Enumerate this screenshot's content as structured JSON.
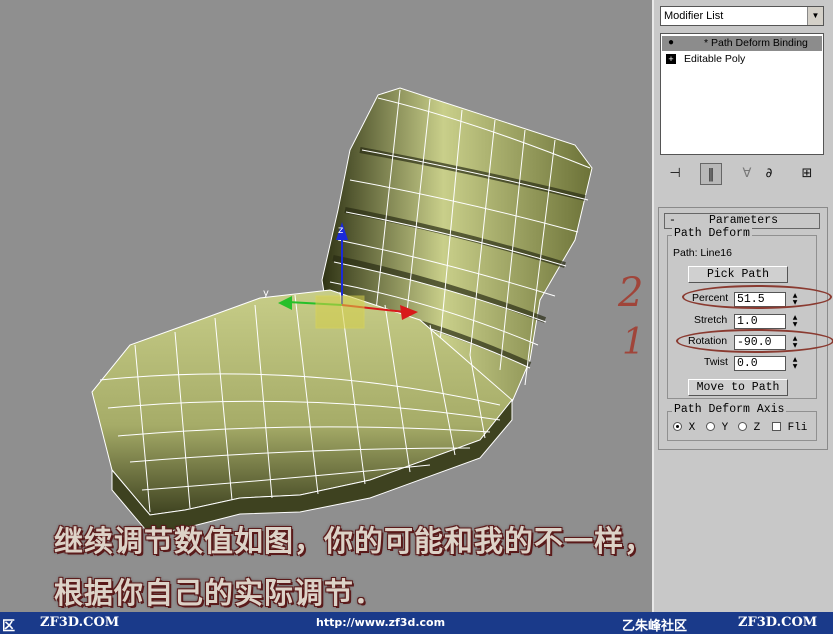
{
  "panel": {
    "modifier_list": "Modifier List",
    "stack": [
      {
        "label": "* Path Deform Binding",
        "icon": "lightbulb-icon",
        "selected": true
      },
      {
        "label": "Editable Poly",
        "icon": "plus-icon",
        "selected": false
      }
    ],
    "toolbar_icons": [
      "pin-stack-icon",
      "show-end-result-icon",
      "make-unique-icon",
      "remove-modifier-icon",
      "configure-modifier-sets-icon"
    ]
  },
  "parameters": {
    "rollout_minus": "-",
    "rollout_title": "Parameters",
    "group_title": "Path Deform",
    "path_label": "Path: Line16",
    "pick_path": "Pick Path",
    "percent_label": "Percent",
    "percent_value": "51.5",
    "stretch_label": "Stretch",
    "stretch_value": "1.0",
    "rotation_label": "Rotation",
    "rotation_value": "-90.0",
    "twist_label": "Twist",
    "twist_value": "0.0",
    "move_to_path": "Move to Path",
    "axis_group_title": "Path Deform Axis",
    "axis_x": "X",
    "axis_y": "Y",
    "axis_z": "Z",
    "axis_selected": "X",
    "flip_label": "Fli",
    "annotation_2": "2",
    "annotation_1": "1",
    "annotation_color": "#a0453a"
  },
  "caption": {
    "line1": "继续调节数值如图，你的可能和我的不一样，可",
    "line2": "根据你自己的实际调节．"
  },
  "footer": {
    "left_fragment": "区",
    "site_left": "ZF3D.COM",
    "url": "http://www.zf3d.com",
    "community": "乙朱峰社区",
    "site_right": "ZF3D.COM",
    "bg_color": "#1a3a8a"
  },
  "viewport": {
    "gizmo_y_label": "y",
    "gizmo_z_label": "z",
    "model_color": "#b9bf7e"
  }
}
